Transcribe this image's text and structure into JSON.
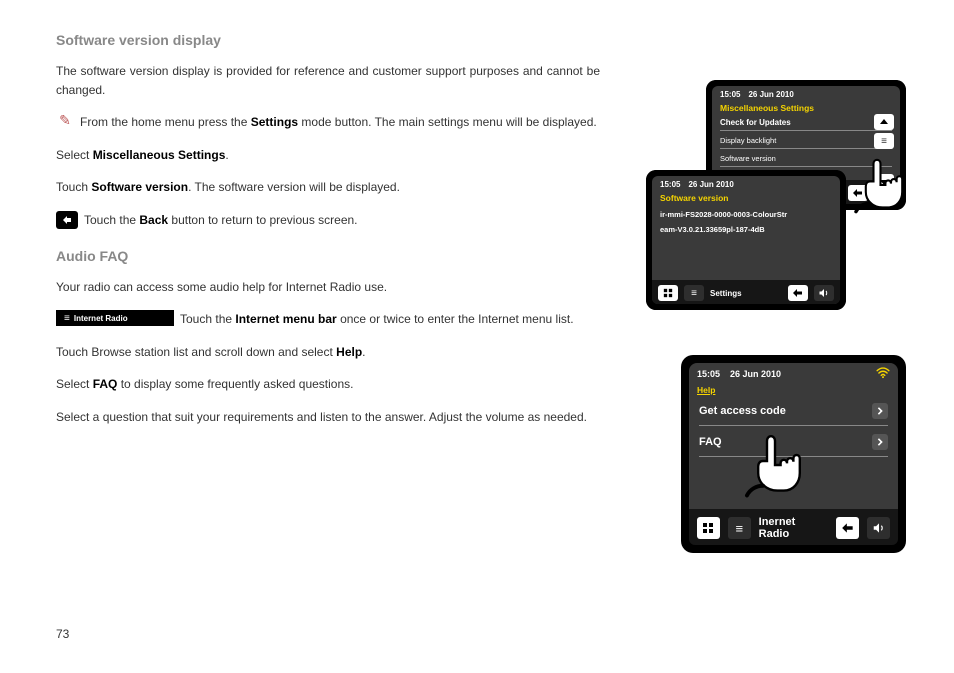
{
  "page_number": "73",
  "section1": {
    "title": "Software version display",
    "p1": "The software version display is provided for reference and customer support purposes and cannot be changed.",
    "step1_a": "From the home menu press the ",
    "step1_b": "Settings",
    "step1_c": " mode button. The main settings menu will be displayed.",
    "p3_a": "Select ",
    "p3_b": "Miscellaneous Settings",
    "p3_c": ".",
    "p4_a": "Touch ",
    "p4_b": "Software version",
    "p4_c": ". The software version will be displayed.",
    "p5_a": "Touch the ",
    "p5_b": "Back",
    "p5_c": " button to return to previous screen."
  },
  "section2": {
    "title": "Audio FAQ",
    "p1": "Your radio can access some audio help for Internet Radio use.",
    "chip": "Internet Radio",
    "p2_a": "Touch the ",
    "p2_b": "Internet menu bar",
    "p2_c": " once or twice to enter the Internet menu list.",
    "p3_a": "Touch Browse station list and scroll down and select ",
    "p3_b": "Help",
    "p3_c": ".",
    "p4_a": "Select ",
    "p4_b": "FAQ",
    "p4_c": " to display some frequently asked questions.",
    "p5": "Select a question that suit your requirements and listen to the answer. Adjust the volume as needed."
  },
  "devA": {
    "time": "15:05",
    "date": "26 Jun 2010",
    "header": "Miscellaneous Settings",
    "items": [
      "Check for Updates",
      "Display backlight",
      "Software version"
    ]
  },
  "devB": {
    "time": "15:05",
    "date": "26 Jun 2010",
    "header": "Software  version",
    "line1": "ir-mmi-FS2028-0000-0003-ColourStr",
    "line2": "eam-V3.0.21.33659pl-187-4dB",
    "footer": "Settings"
  },
  "devC": {
    "time": "15:05",
    "date": "26 Jun 2010",
    "header": "Help",
    "row1": "Get  access  code",
    "row2": "FAQ",
    "footer": "Inernet  Radio"
  }
}
